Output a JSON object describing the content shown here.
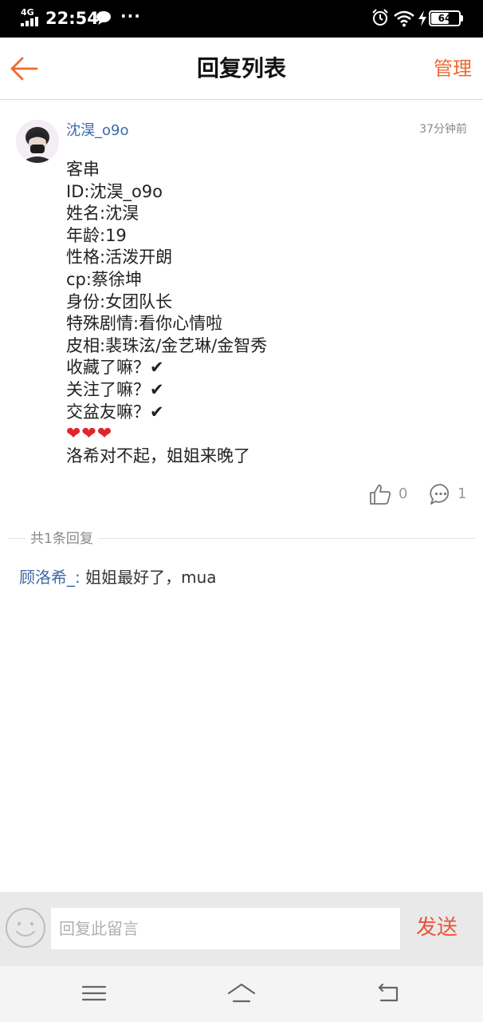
{
  "status_bar": {
    "network": "4G",
    "time": "22:54",
    "more": "···",
    "battery": "64",
    "battery_level": 0.64
  },
  "header": {
    "title": "回复列表",
    "manage_label": "管理"
  },
  "comment": {
    "username": "沈淏_o9o",
    "timestamp": "37分钟前",
    "lines": [
      "客串",
      "ID:沈淏_o9o",
      "姓名:沈淏",
      "年龄:19",
      "性格:活泼开朗",
      "cp:蔡徐坤",
      "身份:女团队长",
      "特殊剧情:看你心情啦",
      "皮相:裴珠泫/金艺琳/金智秀",
      "收藏了嘛？✔",
      "关注了嘛？✔",
      "交盆友嘛？✔",
      "❤❤❤",
      "洛希对不起，姐姐来晚了"
    ],
    "like_count": "0",
    "reply_count": "1"
  },
  "replies": {
    "total_label": "共1条回复",
    "items": [
      {
        "author": "顾洛希_:",
        "text": " 姐姐最好了，mua"
      }
    ]
  },
  "input_bar": {
    "placeholder": "回复此留言",
    "send_label": "发送"
  },
  "colors": {
    "accent": "#ee6a33",
    "send": "#e8563b",
    "link": "#3d6aa8"
  }
}
